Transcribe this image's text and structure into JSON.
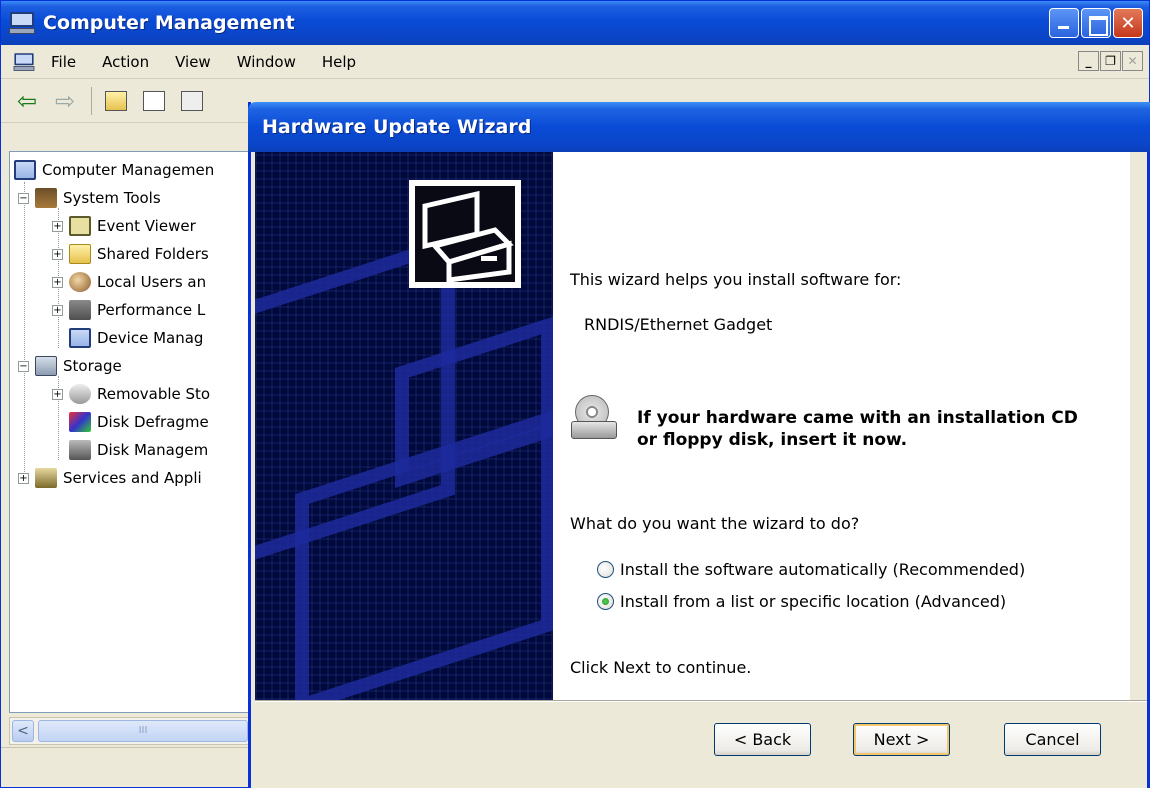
{
  "main_window": {
    "title": "Computer Management",
    "menu": [
      "File",
      "Action",
      "View",
      "Window",
      "Help"
    ]
  },
  "tree": {
    "items": [
      {
        "label": "Computer Managemen",
        "icon": "computer-icon",
        "level": 0,
        "expander": ""
      },
      {
        "label": "System Tools",
        "icon": "tools-icon",
        "level": 1,
        "expander": "−"
      },
      {
        "label": "Event Viewer",
        "icon": "event-viewer-icon",
        "level": 2,
        "expander": "+"
      },
      {
        "label": "Shared Folders",
        "icon": "folder-icon",
        "level": 2,
        "expander": "+"
      },
      {
        "label": "Local Users an",
        "icon": "users-icon",
        "level": 2,
        "expander": "+"
      },
      {
        "label": "Performance L",
        "icon": "performance-icon",
        "level": 2,
        "expander": "+"
      },
      {
        "label": "Device Manag",
        "icon": "device-manager-icon",
        "level": 2,
        "expander": ""
      },
      {
        "label": "Storage",
        "icon": "storage-icon",
        "level": 1,
        "expander": "−"
      },
      {
        "label": "Removable Sto",
        "icon": "removable-storage-icon",
        "level": 2,
        "expander": "+"
      },
      {
        "label": "Disk Defragme",
        "icon": "defrag-icon",
        "level": 2,
        "expander": ""
      },
      {
        "label": "Disk Managem",
        "icon": "disk-management-icon",
        "level": 2,
        "expander": ""
      },
      {
        "label": "Services and Appli",
        "icon": "services-icon",
        "level": 1,
        "expander": "+"
      }
    ]
  },
  "scrollbar": {
    "thumb_grip": "III"
  },
  "wizard": {
    "title": "Hardware Update Wizard",
    "intro": "This wizard helps you install software for:",
    "device_name": "RNDIS/Ethernet Gadget",
    "cd_message_line1": "If your hardware came with an installation CD",
    "cd_message_line2": "or floppy disk, insert it now.",
    "question": "What do you want the wizard to do?",
    "options": [
      {
        "label": "Install the software automatically (Recommended)",
        "checked": false
      },
      {
        "label": "Install from a list or specific location (Advanced)",
        "checked": true
      }
    ],
    "continue_hint": "Click Next to continue.",
    "buttons": {
      "back": "< Back",
      "next": "Next >",
      "cancel": "Cancel"
    }
  },
  "colors": {
    "titlebar_blue": "#0a4bd6",
    "window_face": "#ece9d8",
    "wizard_side_panel": "#000a3a"
  }
}
